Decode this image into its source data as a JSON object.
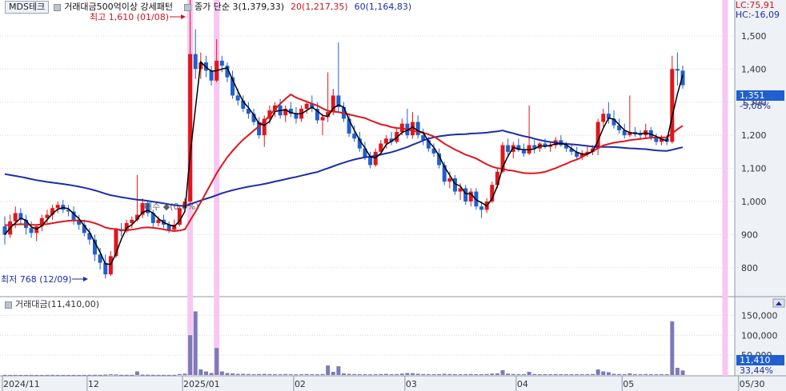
{
  "header": {
    "ticker": "MDS테크",
    "indicator_label": "거래대금500억이상 강세패턴",
    "close_legend": "종가 단순 3(1,379,33)",
    "ma20_legend": "20(1,217,35)",
    "ma60_legend": "60(1,164,83)",
    "lc_label": "LC:75,91",
    "hc_label": "HC:-16,09"
  },
  "volume_panel": {
    "legend": "거래대금(11,410,00)",
    "axis_labels": [
      "150,000",
      "100,000",
      "50,000"
    ],
    "current_value": "11,410",
    "current_pct": "33,44%"
  },
  "annotations": {
    "high": "최고 1,610 (01/08)",
    "low": "최저 768 (12/09)",
    "mid": "매수 ◆(0.0%)"
  },
  "price_axis": {
    "labels": [
      "1,500",
      "1,400",
      "1,300",
      "1,200",
      "1,100",
      "1,000",
      "900",
      "800"
    ],
    "current_price": "1,351",
    "current_change": "-3,08%"
  },
  "x_axis": {
    "labels": [
      "2024/11",
      "12",
      "2025/01",
      "02",
      "03",
      "04",
      "05",
      "05/30"
    ]
  },
  "colors": {
    "up": "#e0161b",
    "down": "#1f5fd0",
    "ma20": "#e0161b",
    "ma60": "#1c2da8",
    "close3": "#000000",
    "highlight": "#f8c6f4",
    "volume": "#7d7ab8",
    "grid": "#d6d6d6",
    "price_tag": "#1f5fd0"
  },
  "chart_data": {
    "type": "candlestick",
    "title": "MDS테크",
    "y_range": [
      720,
      1560
    ],
    "volume_range": [
      0,
      175000
    ],
    "series": [
      {
        "name": "종가 단순 3",
        "color": "#000000"
      },
      {
        "name": "20",
        "color": "#e0161b"
      },
      {
        "name": "60",
        "color": "#1c2da8"
      }
    ],
    "candles": [
      {
        "o": 925,
        "h": 955,
        "l": 870,
        "c": 900
      },
      {
        "o": 900,
        "h": 960,
        "l": 890,
        "c": 940
      },
      {
        "o": 940,
        "h": 985,
        "l": 920,
        "c": 965
      },
      {
        "o": 965,
        "h": 980,
        "l": 930,
        "c": 945
      },
      {
        "o": 945,
        "h": 960,
        "l": 900,
        "c": 920
      },
      {
        "o": 920,
        "h": 940,
        "l": 890,
        "c": 905
      },
      {
        "o": 905,
        "h": 930,
        "l": 880,
        "c": 925
      },
      {
        "o": 925,
        "h": 960,
        "l": 910,
        "c": 950
      },
      {
        "o": 950,
        "h": 975,
        "l": 935,
        "c": 960
      },
      {
        "o": 960,
        "h": 990,
        "l": 945,
        "c": 980
      },
      {
        "o": 980,
        "h": 1000,
        "l": 965,
        "c": 990
      },
      {
        "o": 990,
        "h": 1005,
        "l": 965,
        "c": 975
      },
      {
        "o": 975,
        "h": 990,
        "l": 955,
        "c": 970
      },
      {
        "o": 970,
        "h": 985,
        "l": 930,
        "c": 945
      },
      {
        "o": 945,
        "h": 960,
        "l": 915,
        "c": 930
      },
      {
        "o": 930,
        "h": 945,
        "l": 895,
        "c": 905
      },
      {
        "o": 905,
        "h": 920,
        "l": 870,
        "c": 885
      },
      {
        "o": 885,
        "h": 900,
        "l": 820,
        "c": 840
      },
      {
        "o": 840,
        "h": 860,
        "l": 795,
        "c": 815
      },
      {
        "o": 815,
        "h": 840,
        "l": 768,
        "c": 780
      },
      {
        "o": 780,
        "h": 850,
        "l": 775,
        "c": 835
      },
      {
        "o": 835,
        "h": 920,
        "l": 830,
        "c": 915
      },
      {
        "o": 915,
        "h": 935,
        "l": 895,
        "c": 910
      },
      {
        "o": 910,
        "h": 945,
        "l": 905,
        "c": 935
      },
      {
        "o": 935,
        "h": 955,
        "l": 920,
        "c": 945
      },
      {
        "o": 945,
        "h": 1080,
        "l": 940,
        "c": 960
      },
      {
        "o": 960,
        "h": 1010,
        "l": 950,
        "c": 995
      },
      {
        "o": 995,
        "h": 1000,
        "l": 955,
        "c": 965
      },
      {
        "o": 965,
        "h": 975,
        "l": 920,
        "c": 935
      },
      {
        "o": 935,
        "h": 955,
        "l": 925,
        "c": 945
      },
      {
        "o": 945,
        "h": 960,
        "l": 920,
        "c": 930
      },
      {
        "o": 930,
        "h": 940,
        "l": 905,
        "c": 915
      },
      {
        "o": 915,
        "h": 945,
        "l": 910,
        "c": 930
      },
      {
        "o": 930,
        "h": 985,
        "l": 925,
        "c": 980
      },
      {
        "o": 980,
        "h": 1010,
        "l": 970,
        "c": 1000
      },
      {
        "o": 1000,
        "h": 1610,
        "l": 995,
        "c": 1445
      },
      {
        "o": 1445,
        "h": 1520,
        "l": 1370,
        "c": 1400
      },
      {
        "o": 1400,
        "h": 1450,
        "l": 1370,
        "c": 1420
      },
      {
        "o": 1420,
        "h": 1440,
        "l": 1375,
        "c": 1395
      },
      {
        "o": 1395,
        "h": 1410,
        "l": 1350,
        "c": 1365
      },
      {
        "o": 1365,
        "h": 1490,
        "l": 1360,
        "c": 1425
      },
      {
        "o": 1425,
        "h": 1440,
        "l": 1390,
        "c": 1410
      },
      {
        "o": 1410,
        "h": 1420,
        "l": 1360,
        "c": 1375
      },
      {
        "o": 1375,
        "h": 1395,
        "l": 1310,
        "c": 1320
      },
      {
        "o": 1320,
        "h": 1340,
        "l": 1290,
        "c": 1305
      },
      {
        "o": 1305,
        "h": 1320,
        "l": 1270,
        "c": 1280
      },
      {
        "o": 1280,
        "h": 1300,
        "l": 1250,
        "c": 1265
      },
      {
        "o": 1265,
        "h": 1280,
        "l": 1230,
        "c": 1240
      },
      {
        "o": 1240,
        "h": 1255,
        "l": 1190,
        "c": 1200
      },
      {
        "o": 1200,
        "h": 1260,
        "l": 1165,
        "c": 1250
      },
      {
        "o": 1250,
        "h": 1290,
        "l": 1235,
        "c": 1275
      },
      {
        "o": 1275,
        "h": 1300,
        "l": 1255,
        "c": 1290
      },
      {
        "o": 1290,
        "h": 1310,
        "l": 1250,
        "c": 1260
      },
      {
        "o": 1260,
        "h": 1290,
        "l": 1240,
        "c": 1280
      },
      {
        "o": 1280,
        "h": 1300,
        "l": 1255,
        "c": 1265
      },
      {
        "o": 1265,
        "h": 1285,
        "l": 1235,
        "c": 1250
      },
      {
        "o": 1250,
        "h": 1290,
        "l": 1240,
        "c": 1280
      },
      {
        "o": 1280,
        "h": 1305,
        "l": 1265,
        "c": 1295
      },
      {
        "o": 1295,
        "h": 1320,
        "l": 1270,
        "c": 1280
      },
      {
        "o": 1280,
        "h": 1300,
        "l": 1235,
        "c": 1245
      },
      {
        "o": 1245,
        "h": 1265,
        "l": 1200,
        "c": 1255
      },
      {
        "o": 1255,
        "h": 1390,
        "l": 1240,
        "c": 1270
      },
      {
        "o": 1270,
        "h": 1340,
        "l": 1260,
        "c": 1320
      },
      {
        "o": 1320,
        "h": 1480,
        "l": 1270,
        "c": 1285
      },
      {
        "o": 1285,
        "h": 1300,
        "l": 1240,
        "c": 1250
      },
      {
        "o": 1250,
        "h": 1265,
        "l": 1195,
        "c": 1205
      },
      {
        "o": 1205,
        "h": 1230,
        "l": 1180,
        "c": 1190
      },
      {
        "o": 1190,
        "h": 1210,
        "l": 1150,
        "c": 1160
      },
      {
        "o": 1160,
        "h": 1180,
        "l": 1125,
        "c": 1135
      },
      {
        "o": 1135,
        "h": 1150,
        "l": 1100,
        "c": 1110
      },
      {
        "o": 1110,
        "h": 1160,
        "l": 1105,
        "c": 1150
      },
      {
        "o": 1150,
        "h": 1185,
        "l": 1140,
        "c": 1175
      },
      {
        "o": 1175,
        "h": 1200,
        "l": 1160,
        "c": 1190
      },
      {
        "o": 1190,
        "h": 1210,
        "l": 1170,
        "c": 1180
      },
      {
        "o": 1180,
        "h": 1220,
        "l": 1175,
        "c": 1210
      },
      {
        "o": 1210,
        "h": 1250,
        "l": 1200,
        "c": 1235
      },
      {
        "o": 1235,
        "h": 1280,
        "l": 1190,
        "c": 1200
      },
      {
        "o": 1200,
        "h": 1270,
        "l": 1190,
        "c": 1240
      },
      {
        "o": 1240,
        "h": 1260,
        "l": 1190,
        "c": 1200
      },
      {
        "o": 1200,
        "h": 1220,
        "l": 1170,
        "c": 1185
      },
      {
        "o": 1185,
        "h": 1195,
        "l": 1150,
        "c": 1160
      },
      {
        "o": 1160,
        "h": 1175,
        "l": 1135,
        "c": 1145
      },
      {
        "o": 1145,
        "h": 1160,
        "l": 1100,
        "c": 1110
      },
      {
        "o": 1110,
        "h": 1120,
        "l": 1050,
        "c": 1060
      },
      {
        "o": 1060,
        "h": 1090,
        "l": 1040,
        "c": 1070
      },
      {
        "o": 1070,
        "h": 1080,
        "l": 1020,
        "c": 1030
      },
      {
        "o": 1030,
        "h": 1055,
        "l": 1005,
        "c": 1040
      },
      {
        "o": 1040,
        "h": 1050,
        "l": 990,
        "c": 1000
      },
      {
        "o": 1000,
        "h": 1040,
        "l": 985,
        "c": 1030
      },
      {
        "o": 1030,
        "h": 1040,
        "l": 975,
        "c": 985
      },
      {
        "o": 985,
        "h": 1000,
        "l": 950,
        "c": 975
      },
      {
        "o": 975,
        "h": 1010,
        "l": 965,
        "c": 1000
      },
      {
        "o": 1000,
        "h": 1060,
        "l": 995,
        "c": 1050
      },
      {
        "o": 1050,
        "h": 1100,
        "l": 1040,
        "c": 1090
      },
      {
        "o": 1090,
        "h": 1180,
        "l": 1085,
        "c": 1170
      },
      {
        "o": 1170,
        "h": 1190,
        "l": 1140,
        "c": 1150
      },
      {
        "o": 1150,
        "h": 1180,
        "l": 1130,
        "c": 1170
      },
      {
        "o": 1170,
        "h": 1190,
        "l": 1150,
        "c": 1155
      },
      {
        "o": 1155,
        "h": 1175,
        "l": 1135,
        "c": 1145
      },
      {
        "o": 1145,
        "h": 1290,
        "l": 1140,
        "c": 1170
      },
      {
        "o": 1170,
        "h": 1185,
        "l": 1145,
        "c": 1160
      },
      {
        "o": 1160,
        "h": 1180,
        "l": 1150,
        "c": 1175
      },
      {
        "o": 1175,
        "h": 1190,
        "l": 1160,
        "c": 1165
      },
      {
        "o": 1165,
        "h": 1180,
        "l": 1150,
        "c": 1170
      },
      {
        "o": 1170,
        "h": 1195,
        "l": 1160,
        "c": 1185
      },
      {
        "o": 1185,
        "h": 1200,
        "l": 1165,
        "c": 1170
      },
      {
        "o": 1170,
        "h": 1180,
        "l": 1150,
        "c": 1160
      },
      {
        "o": 1160,
        "h": 1175,
        "l": 1140,
        "c": 1150
      },
      {
        "o": 1150,
        "h": 1165,
        "l": 1125,
        "c": 1135
      },
      {
        "o": 1135,
        "h": 1155,
        "l": 1125,
        "c": 1145
      },
      {
        "o": 1145,
        "h": 1165,
        "l": 1135,
        "c": 1150
      },
      {
        "o": 1150,
        "h": 1170,
        "l": 1140,
        "c": 1160
      },
      {
        "o": 1160,
        "h": 1250,
        "l": 1140,
        "c": 1240
      },
      {
        "o": 1240,
        "h": 1280,
        "l": 1225,
        "c": 1265
      },
      {
        "o": 1265,
        "h": 1300,
        "l": 1235,
        "c": 1250
      },
      {
        "o": 1250,
        "h": 1275,
        "l": 1220,
        "c": 1230
      },
      {
        "o": 1230,
        "h": 1250,
        "l": 1205,
        "c": 1215
      },
      {
        "o": 1215,
        "h": 1235,
        "l": 1190,
        "c": 1200
      },
      {
        "o": 1200,
        "h": 1320,
        "l": 1195,
        "c": 1210
      },
      {
        "o": 1210,
        "h": 1225,
        "l": 1195,
        "c": 1205
      },
      {
        "o": 1205,
        "h": 1215,
        "l": 1190,
        "c": 1200
      },
      {
        "o": 1200,
        "h": 1235,
        "l": 1190,
        "c": 1215
      },
      {
        "o": 1215,
        "h": 1225,
        "l": 1185,
        "c": 1195
      },
      {
        "o": 1195,
        "h": 1205,
        "l": 1170,
        "c": 1180
      },
      {
        "o": 1180,
        "h": 1200,
        "l": 1170,
        "c": 1190
      },
      {
        "o": 1190,
        "h": 1200,
        "l": 1170,
        "c": 1180
      },
      {
        "o": 1180,
        "h": 1440,
        "l": 1175,
        "c": 1400
      },
      {
        "o": 1400,
        "h": 1450,
        "l": 1350,
        "c": 1395
      },
      {
        "o": 1395,
        "h": 1410,
        "l": 1340,
        "c": 1351
      }
    ],
    "volume": [
      300,
      200,
      300,
      200,
      200,
      300,
      200,
      200,
      300,
      400,
      200,
      200,
      200,
      300,
      200,
      300,
      400,
      600,
      500,
      1200,
      1800,
      1400,
      500,
      500,
      400,
      9000,
      1000,
      800,
      600,
      400,
      400,
      300,
      400,
      2500,
      3500,
      100000,
      160000,
      14000,
      9000,
      5000,
      68000,
      9000,
      5000,
      4000,
      3000,
      3000,
      2500,
      2000,
      2500,
      3000,
      2500,
      2000,
      2000,
      2500,
      2000,
      1800,
      2000,
      2500,
      2000,
      1800,
      2500,
      24000,
      8000,
      22000,
      4000,
      3000,
      2500,
      2200,
      2000,
      1800,
      2000,
      2500,
      3000,
      2000,
      2500,
      3500,
      5000,
      4500,
      3000,
      2500,
      2000,
      2000,
      2200,
      3000,
      2500,
      2200,
      2000,
      2200,
      2500,
      2200,
      2000,
      2500,
      3500,
      4000,
      12000,
      3500,
      2500,
      2200,
      2000,
      8000,
      2500,
      2000,
      2200,
      2000,
      2500,
      2200,
      2000,
      2000,
      2200,
      2000,
      2200,
      2500,
      14000,
      9000,
      7000,
      3000,
      2500,
      2200,
      4000,
      2200,
      2000,
      2500,
      2200,
      2000,
      2200,
      2000,
      135000,
      18000,
      11410
    ],
    "highlight_bars": [
      35,
      40,
      136
    ],
    "x_labels_at": [
      [
        0,
        "2024/11"
      ],
      [
        16,
        "12"
      ],
      [
        34,
        "2025/01"
      ],
      [
        55,
        "02"
      ],
      [
        76,
        "03"
      ],
      [
        97,
        "04"
      ],
      [
        117,
        "05"
      ],
      [
        139,
        "05/30"
      ]
    ]
  }
}
